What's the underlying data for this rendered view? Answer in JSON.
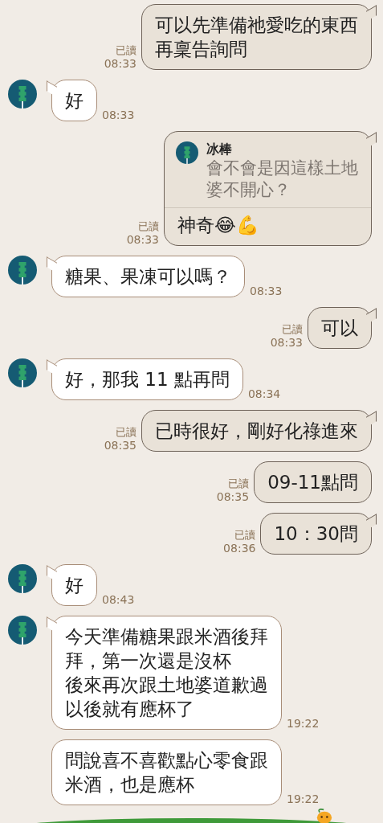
{
  "messages": [
    {
      "kind": "sent",
      "tail": true,
      "read": "已讀",
      "time": "08:33",
      "paragraphs": [
        "可以先準備祂愛吃的東西再稟告詢問"
      ]
    },
    {
      "kind": "received",
      "avatar": true,
      "tail": true,
      "time": "08:33",
      "paragraphs": [
        "好"
      ]
    },
    {
      "kind": "sent",
      "tail": true,
      "read": "已讀",
      "time": "08:33",
      "reply": {
        "name": "冰棒",
        "text": "會不會是因這樣土地婆不開心？"
      },
      "paragraphs": [
        "神奇😂💪"
      ]
    },
    {
      "kind": "received",
      "avatar": true,
      "tail": true,
      "time": "08:33",
      "paragraphs": [
        "糖果、果凍可以嗎？"
      ]
    },
    {
      "kind": "sent",
      "tail": true,
      "read": "已讀",
      "time": "08:33",
      "paragraphs": [
        "可以"
      ]
    },
    {
      "kind": "received",
      "avatar": true,
      "tail": true,
      "time": "08:34",
      "paragraphs": [
        "好，那我 11 點再問"
      ]
    },
    {
      "kind": "sent",
      "tail": true,
      "read": "已讀",
      "time": "08:35",
      "paragraphs": [
        "已時很好，剛好化祿進來"
      ]
    },
    {
      "kind": "sent",
      "tail": false,
      "read": "已讀",
      "time": "08:35",
      "paragraphs": [
        "09-11點問"
      ]
    },
    {
      "kind": "sent",
      "tail": true,
      "read": "已讀",
      "time": "08:36",
      "paragraphs": [
        "10：30問"
      ]
    },
    {
      "kind": "received",
      "avatar": true,
      "tail": true,
      "time": "08:43",
      "paragraphs": [
        "好"
      ]
    },
    {
      "kind": "received",
      "avatar": true,
      "tail": true,
      "time": "19:22",
      "paragraphs": [
        "今天準備糖果跟米酒後拜拜，第一次還是沒杯",
        "後來再次跟土地婆道歉過以後就有應杯了"
      ]
    },
    {
      "kind": "received",
      "avatar": false,
      "tail": false,
      "time": "19:22",
      "paragraphs": [
        "問說喜不喜歡點心零食跟米酒，也是應杯"
      ]
    }
  ]
}
